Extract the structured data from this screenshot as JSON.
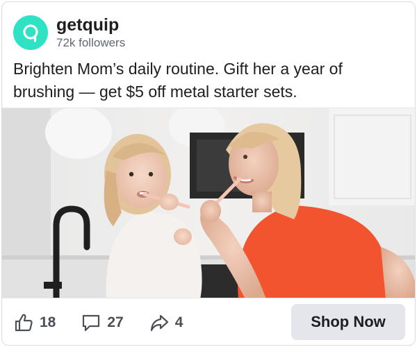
{
  "post": {
    "brand_name": "getquip",
    "followers": "72k followers",
    "caption": "Brighten Mom’s daily routine. Gift her a year of brushing — get $5 off metal starter sets.",
    "logo_color": "#2fe2c4"
  },
  "photo": {
    "subject": "mother-and-daughter-brushing-teeth"
  },
  "engagement": {
    "likes": "18",
    "comments": "27",
    "shares": "4"
  },
  "cta": {
    "label": "Shop Now"
  }
}
